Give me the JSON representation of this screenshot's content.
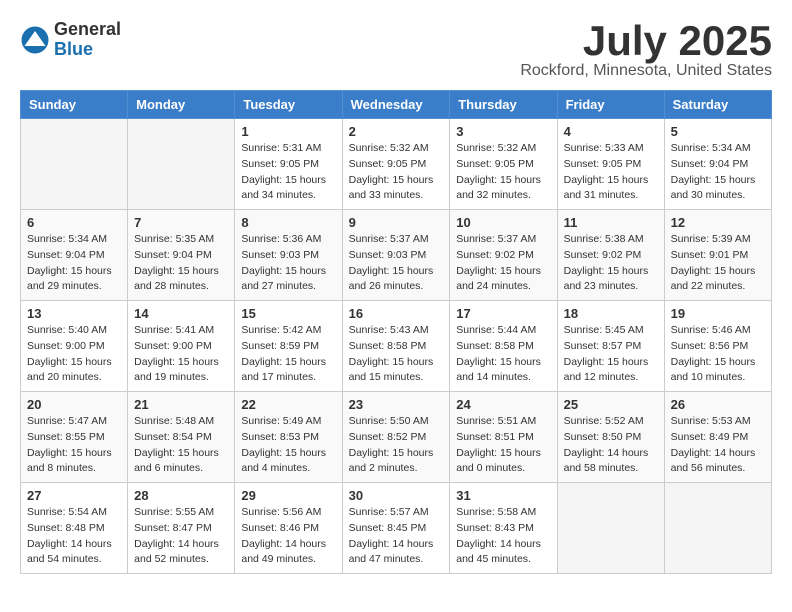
{
  "header": {
    "logo_general": "General",
    "logo_blue": "Blue",
    "month_title": "July 2025",
    "location": "Rockford, Minnesota, United States"
  },
  "weekdays": [
    "Sunday",
    "Monday",
    "Tuesday",
    "Wednesday",
    "Thursday",
    "Friday",
    "Saturday"
  ],
  "weeks": [
    [
      {
        "num": "",
        "sunrise": "",
        "sunset": "",
        "daylight": ""
      },
      {
        "num": "",
        "sunrise": "",
        "sunset": "",
        "daylight": ""
      },
      {
        "num": "1",
        "sunrise": "Sunrise: 5:31 AM",
        "sunset": "Sunset: 9:05 PM",
        "daylight": "Daylight: 15 hours and 34 minutes."
      },
      {
        "num": "2",
        "sunrise": "Sunrise: 5:32 AM",
        "sunset": "Sunset: 9:05 PM",
        "daylight": "Daylight: 15 hours and 33 minutes."
      },
      {
        "num": "3",
        "sunrise": "Sunrise: 5:32 AM",
        "sunset": "Sunset: 9:05 PM",
        "daylight": "Daylight: 15 hours and 32 minutes."
      },
      {
        "num": "4",
        "sunrise": "Sunrise: 5:33 AM",
        "sunset": "Sunset: 9:05 PM",
        "daylight": "Daylight: 15 hours and 31 minutes."
      },
      {
        "num": "5",
        "sunrise": "Sunrise: 5:34 AM",
        "sunset": "Sunset: 9:04 PM",
        "daylight": "Daylight: 15 hours and 30 minutes."
      }
    ],
    [
      {
        "num": "6",
        "sunrise": "Sunrise: 5:34 AM",
        "sunset": "Sunset: 9:04 PM",
        "daylight": "Daylight: 15 hours and 29 minutes."
      },
      {
        "num": "7",
        "sunrise": "Sunrise: 5:35 AM",
        "sunset": "Sunset: 9:04 PM",
        "daylight": "Daylight: 15 hours and 28 minutes."
      },
      {
        "num": "8",
        "sunrise": "Sunrise: 5:36 AM",
        "sunset": "Sunset: 9:03 PM",
        "daylight": "Daylight: 15 hours and 27 minutes."
      },
      {
        "num": "9",
        "sunrise": "Sunrise: 5:37 AM",
        "sunset": "Sunset: 9:03 PM",
        "daylight": "Daylight: 15 hours and 26 minutes."
      },
      {
        "num": "10",
        "sunrise": "Sunrise: 5:37 AM",
        "sunset": "Sunset: 9:02 PM",
        "daylight": "Daylight: 15 hours and 24 minutes."
      },
      {
        "num": "11",
        "sunrise": "Sunrise: 5:38 AM",
        "sunset": "Sunset: 9:02 PM",
        "daylight": "Daylight: 15 hours and 23 minutes."
      },
      {
        "num": "12",
        "sunrise": "Sunrise: 5:39 AM",
        "sunset": "Sunset: 9:01 PM",
        "daylight": "Daylight: 15 hours and 22 minutes."
      }
    ],
    [
      {
        "num": "13",
        "sunrise": "Sunrise: 5:40 AM",
        "sunset": "Sunset: 9:00 PM",
        "daylight": "Daylight: 15 hours and 20 minutes."
      },
      {
        "num": "14",
        "sunrise": "Sunrise: 5:41 AM",
        "sunset": "Sunset: 9:00 PM",
        "daylight": "Daylight: 15 hours and 19 minutes."
      },
      {
        "num": "15",
        "sunrise": "Sunrise: 5:42 AM",
        "sunset": "Sunset: 8:59 PM",
        "daylight": "Daylight: 15 hours and 17 minutes."
      },
      {
        "num": "16",
        "sunrise": "Sunrise: 5:43 AM",
        "sunset": "Sunset: 8:58 PM",
        "daylight": "Daylight: 15 hours and 15 minutes."
      },
      {
        "num": "17",
        "sunrise": "Sunrise: 5:44 AM",
        "sunset": "Sunset: 8:58 PM",
        "daylight": "Daylight: 15 hours and 14 minutes."
      },
      {
        "num": "18",
        "sunrise": "Sunrise: 5:45 AM",
        "sunset": "Sunset: 8:57 PM",
        "daylight": "Daylight: 15 hours and 12 minutes."
      },
      {
        "num": "19",
        "sunrise": "Sunrise: 5:46 AM",
        "sunset": "Sunset: 8:56 PM",
        "daylight": "Daylight: 15 hours and 10 minutes."
      }
    ],
    [
      {
        "num": "20",
        "sunrise": "Sunrise: 5:47 AM",
        "sunset": "Sunset: 8:55 PM",
        "daylight": "Daylight: 15 hours and 8 minutes."
      },
      {
        "num": "21",
        "sunrise": "Sunrise: 5:48 AM",
        "sunset": "Sunset: 8:54 PM",
        "daylight": "Daylight: 15 hours and 6 minutes."
      },
      {
        "num": "22",
        "sunrise": "Sunrise: 5:49 AM",
        "sunset": "Sunset: 8:53 PM",
        "daylight": "Daylight: 15 hours and 4 minutes."
      },
      {
        "num": "23",
        "sunrise": "Sunrise: 5:50 AM",
        "sunset": "Sunset: 8:52 PM",
        "daylight": "Daylight: 15 hours and 2 minutes."
      },
      {
        "num": "24",
        "sunrise": "Sunrise: 5:51 AM",
        "sunset": "Sunset: 8:51 PM",
        "daylight": "Daylight: 15 hours and 0 minutes."
      },
      {
        "num": "25",
        "sunrise": "Sunrise: 5:52 AM",
        "sunset": "Sunset: 8:50 PM",
        "daylight": "Daylight: 14 hours and 58 minutes."
      },
      {
        "num": "26",
        "sunrise": "Sunrise: 5:53 AM",
        "sunset": "Sunset: 8:49 PM",
        "daylight": "Daylight: 14 hours and 56 minutes."
      }
    ],
    [
      {
        "num": "27",
        "sunrise": "Sunrise: 5:54 AM",
        "sunset": "Sunset: 8:48 PM",
        "daylight": "Daylight: 14 hours and 54 minutes."
      },
      {
        "num": "28",
        "sunrise": "Sunrise: 5:55 AM",
        "sunset": "Sunset: 8:47 PM",
        "daylight": "Daylight: 14 hours and 52 minutes."
      },
      {
        "num": "29",
        "sunrise": "Sunrise: 5:56 AM",
        "sunset": "Sunset: 8:46 PM",
        "daylight": "Daylight: 14 hours and 49 minutes."
      },
      {
        "num": "30",
        "sunrise": "Sunrise: 5:57 AM",
        "sunset": "Sunset: 8:45 PM",
        "daylight": "Daylight: 14 hours and 47 minutes."
      },
      {
        "num": "31",
        "sunrise": "Sunrise: 5:58 AM",
        "sunset": "Sunset: 8:43 PM",
        "daylight": "Daylight: 14 hours and 45 minutes."
      },
      {
        "num": "",
        "sunrise": "",
        "sunset": "",
        "daylight": ""
      },
      {
        "num": "",
        "sunrise": "",
        "sunset": "",
        "daylight": ""
      }
    ]
  ]
}
